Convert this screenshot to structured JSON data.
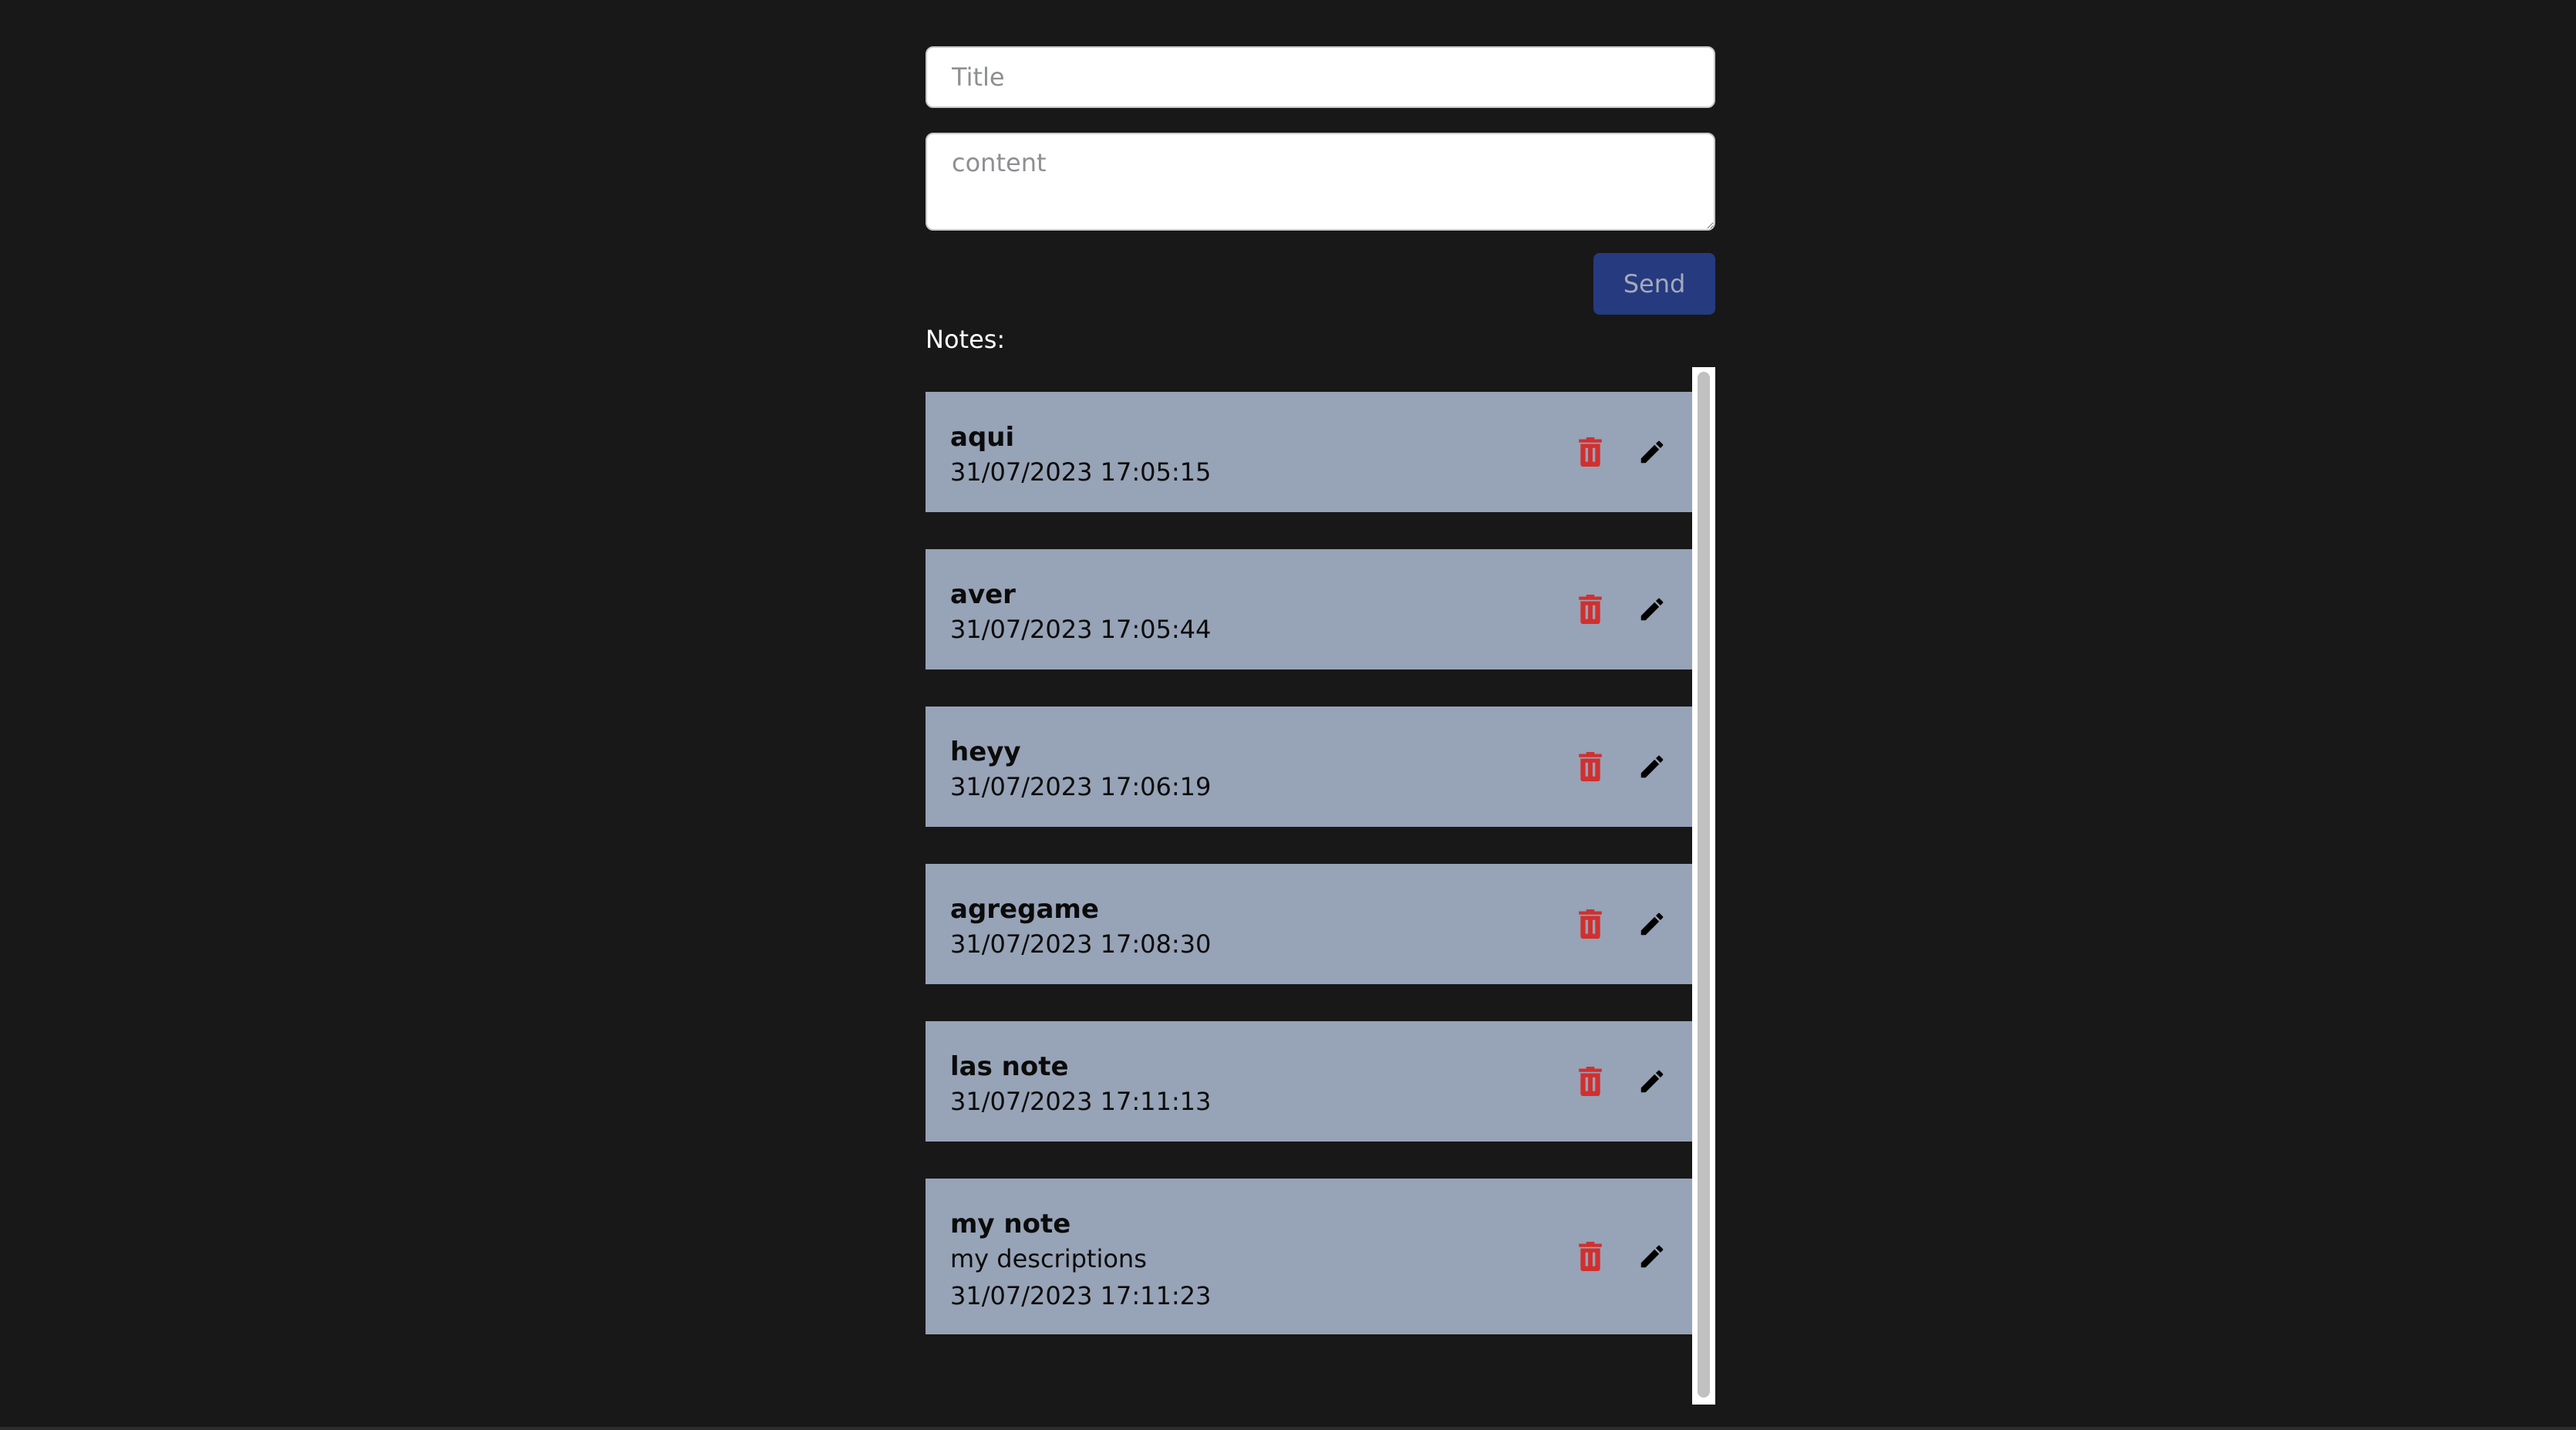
{
  "form": {
    "title_placeholder": "Title",
    "title_value": "",
    "content_placeholder": "content",
    "content_value": "",
    "send_label": "Send"
  },
  "notes_label": "Notes:",
  "notes": [
    {
      "title": "aqui",
      "description": "",
      "timestamp": "31/07/2023 17:05:15"
    },
    {
      "title": "aver",
      "description": "",
      "timestamp": "31/07/2023 17:05:44"
    },
    {
      "title": "heyy",
      "description": "",
      "timestamp": "31/07/2023 17:06:19"
    },
    {
      "title": "agregame",
      "description": "",
      "timestamp": "31/07/2023 17:08:30"
    },
    {
      "title": "las note",
      "description": "",
      "timestamp": "31/07/2023 17:11:13"
    },
    {
      "title": "my note",
      "description": "my descriptions",
      "timestamp": "31/07/2023 17:11:23"
    }
  ],
  "icons": {
    "delete": "trash-icon",
    "edit": "pencil-icon"
  },
  "colors": {
    "background": "#181818",
    "note_card": "#97a3b6",
    "send_button": "#263a80",
    "send_text": "#a4aab8",
    "delete_icon": "#d0302f",
    "edit_icon": "#000000"
  }
}
